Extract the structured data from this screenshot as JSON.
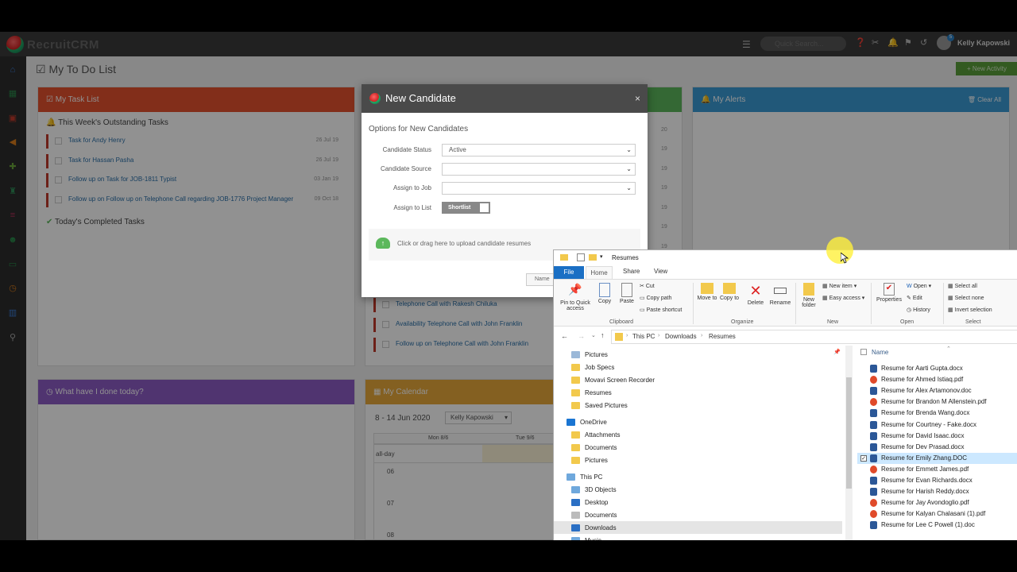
{
  "topbar": {
    "search_placeholder": "Quick Search...",
    "user_name": "Kelly Kapowski",
    "notification_count": "5",
    "logo_text": "RecruitCRM"
  },
  "page": {
    "title": "My To Do List",
    "new_activity": "+ New Activity"
  },
  "tasks": {
    "header": "My Task List",
    "outstanding_label": "This Week's Outstanding Tasks",
    "completed_label": "Today's Completed Tasks",
    "items": [
      {
        "label": "Task for Andy Henry",
        "date": "26 Jul 19"
      },
      {
        "label": "Task for Hassan Pasha",
        "date": "26 Jul 19"
      },
      {
        "label": "Follow up on Task for JOB-1811 Typist",
        "date": "03 Jan 19"
      },
      {
        "label": "Follow up on Follow up on Telephone Call regarding JOB-1776 Project Manager",
        "date": "09 Oct 18"
      }
    ]
  },
  "activities": {
    "items": [
      "Telephone Call with Rakesh Chiluka",
      "Availability Telephone Call with John Franklin",
      "Follow up on Telephone Call with John Franklin"
    ],
    "partial_dates": [
      "20",
      "19",
      "19",
      "19",
      "19",
      "19",
      "19"
    ]
  },
  "alerts": {
    "header": "My Alerts",
    "clear_all": "Clear All"
  },
  "done_today": {
    "header": "What have I done today?"
  },
  "calendar": {
    "header": "My Calendar",
    "range": "8 - 14 Jun 2020",
    "user_select": "Kelly Kapowski",
    "days": [
      "Mon 8/6",
      "Tue 9/6"
    ],
    "allday": "all-day",
    "hours": [
      "06",
      "07",
      "08"
    ]
  },
  "modal": {
    "title": "New Candidate",
    "options_heading": "Options for New Candidates",
    "status_label": "Candidate Status",
    "status_value": "Active",
    "source_label": "Candidate Source",
    "source_value": "",
    "job_label": "Assign to Job",
    "job_value": "",
    "list_label": "Assign to List",
    "list_toggle": "Shortlist",
    "upload_text": "Click or drag here to upload candidate resumes",
    "name_btn": "Name",
    "close": "×"
  },
  "explorer": {
    "window_title": "Resumes",
    "tabs": [
      "File",
      "Home",
      "Share",
      "View"
    ],
    "clipboard": {
      "pin": "Pin to Quick access",
      "copy": "Copy",
      "paste": "Paste",
      "cut": "Cut",
      "copy_path": "Copy path",
      "paste_shortcut": "Paste shortcut",
      "group": "Clipboard"
    },
    "organize": {
      "move": "Move to",
      "copy": "Copy to",
      "delete": "Delete",
      "rename": "Rename",
      "group": "Organize"
    },
    "new": {
      "folder": "New folder",
      "item": "New item",
      "easy": "Easy access",
      "group": "New"
    },
    "open": {
      "properties": "Properties",
      "open": "Open",
      "edit": "Edit",
      "history": "History",
      "group": "Open"
    },
    "select": {
      "all": "Select all",
      "none": "Select none",
      "invert": "Invert selection",
      "group": "Select"
    },
    "path": [
      "This PC",
      "Downloads",
      "Resumes"
    ],
    "nav": [
      {
        "label": "Pictures",
        "type": "pictures"
      },
      {
        "label": "Job Specs",
        "type": "folder"
      },
      {
        "label": "Movavi Screen Recorder",
        "type": "folder"
      },
      {
        "label": "Resumes",
        "type": "folder"
      },
      {
        "label": "Saved Pictures",
        "type": "folder"
      },
      {
        "label": "OneDrive",
        "type": "cloud"
      },
      {
        "label": "Attachments",
        "type": "folder"
      },
      {
        "label": "Documents",
        "type": "folder"
      },
      {
        "label": "Pictures",
        "type": "folder"
      },
      {
        "label": "This PC",
        "type": "pc"
      },
      {
        "label": "3D Objects",
        "type": "3d"
      },
      {
        "label": "Desktop",
        "type": "desktop"
      },
      {
        "label": "Documents",
        "type": "docs"
      },
      {
        "label": "Downloads",
        "type": "downloads"
      },
      {
        "label": "Music",
        "type": "music"
      }
    ],
    "name_header": "Name",
    "files": [
      {
        "name": "Resume for Aarti Gupta.docx",
        "type": "word"
      },
      {
        "name": "Resume for Ahmed Istiaq.pdf",
        "type": "pdf"
      },
      {
        "name": "Resume for Alex Artamonov.doc",
        "type": "word"
      },
      {
        "name": "Resume for Brandon M Allenstein.pdf",
        "type": "pdf"
      },
      {
        "name": "Resume for Brenda Wang.docx",
        "type": "word"
      },
      {
        "name": "Resume for Courtney - Fake.docx",
        "type": "word"
      },
      {
        "name": "Resume for David Isaac.docx",
        "type": "word"
      },
      {
        "name": "Resume for Dev Prasad.docx",
        "type": "word"
      },
      {
        "name": "Resume for Emily Zhang.DOC",
        "type": "word"
      },
      {
        "name": "Resume for Emmett James.pdf",
        "type": "pdf"
      },
      {
        "name": "Resume for Evan Richards.docx",
        "type": "word"
      },
      {
        "name": "Resume for Harish Reddy.docx",
        "type": "word"
      },
      {
        "name": "Resume for Jay Avondoglio.pdf",
        "type": "pdf"
      },
      {
        "name": "Resume for Kalyan Chalasani (1).pdf",
        "type": "pdf"
      },
      {
        "name": "Resume for Lee C Powell (1).doc",
        "type": "word"
      }
    ],
    "selected_file_index": 8
  },
  "colors": {
    "tasks": "#e4512f",
    "alerts": "#3a9bd5",
    "done_today": "#8e5cc5",
    "calendar": "#e8a93a",
    "green_panel": "#5cb85c",
    "new_activity": "#5a9f3a"
  }
}
